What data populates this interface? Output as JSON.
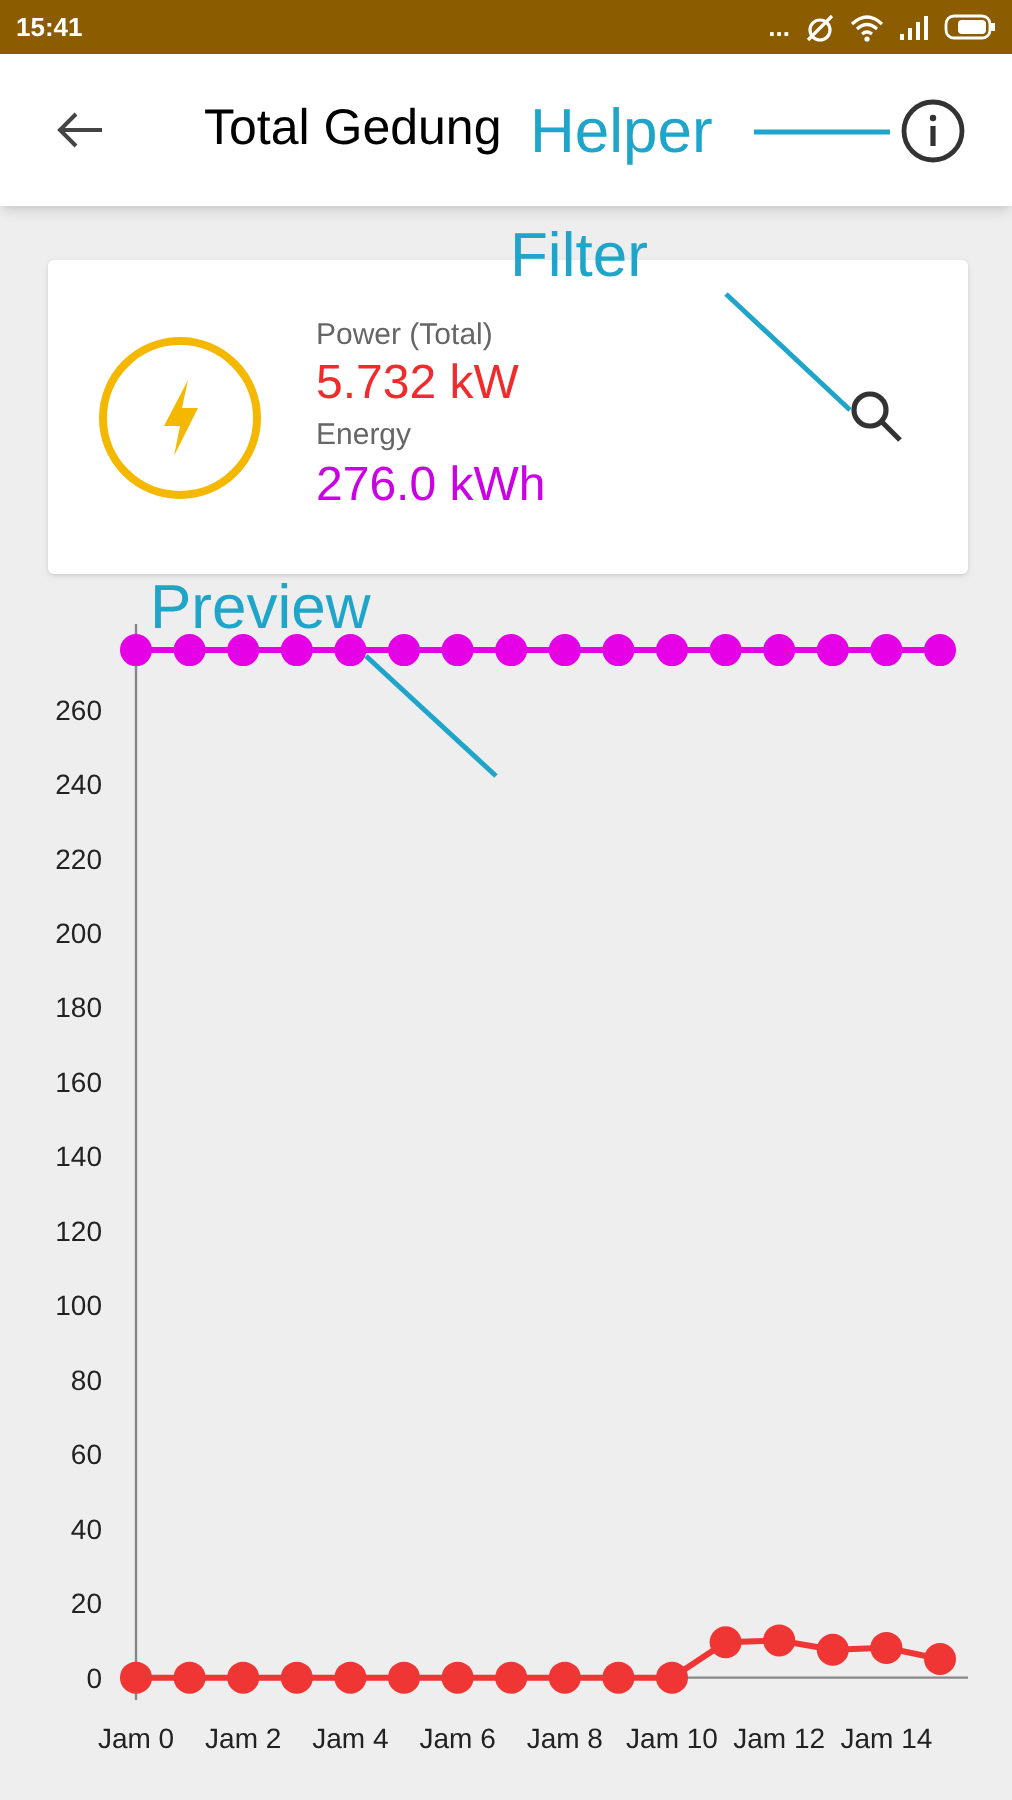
{
  "status_bar": {
    "time": "15:41",
    "dots": "..."
  },
  "app_bar": {
    "title": "Total Gedung"
  },
  "summary": {
    "power_label": "Power (Total)",
    "power_value": "5.732 kW",
    "energy_label": "Energy",
    "energy_value": "276.0 kWh"
  },
  "callouts": [
    {
      "text": "Helper"
    },
    {
      "text": "Filter"
    },
    {
      "text": "Preview"
    }
  ],
  "chart": {
    "chart_data": {
      "type": "line",
      "categories": [
        "Jam 0",
        null,
        "Jam 2",
        null,
        "Jam 4",
        null,
        "Jam 6",
        null,
        "Jam 8",
        null,
        "Jam 10",
        null,
        "Jam 12",
        null,
        "Jam 14",
        null
      ],
      "ylim": [
        -6,
        283
      ],
      "yticks": [
        0,
        20,
        40,
        60,
        80,
        100,
        120,
        140,
        160,
        180,
        200,
        220,
        240,
        260
      ],
      "series": [
        {
          "color": "#e600e6",
          "marker": "circle",
          "values": [
            276,
            276,
            276,
            276,
            276,
            276,
            276,
            276,
            276,
            276,
            276,
            276,
            276,
            276,
            276,
            276
          ]
        },
        {
          "color": "#f03535",
          "marker": "circle",
          "values": [
            0,
            0,
            0,
            0,
            0,
            0,
            0,
            0,
            0,
            0,
            0,
            9.5,
            10,
            7.5,
            8,
            5
          ]
        }
      ]
    }
  }
}
